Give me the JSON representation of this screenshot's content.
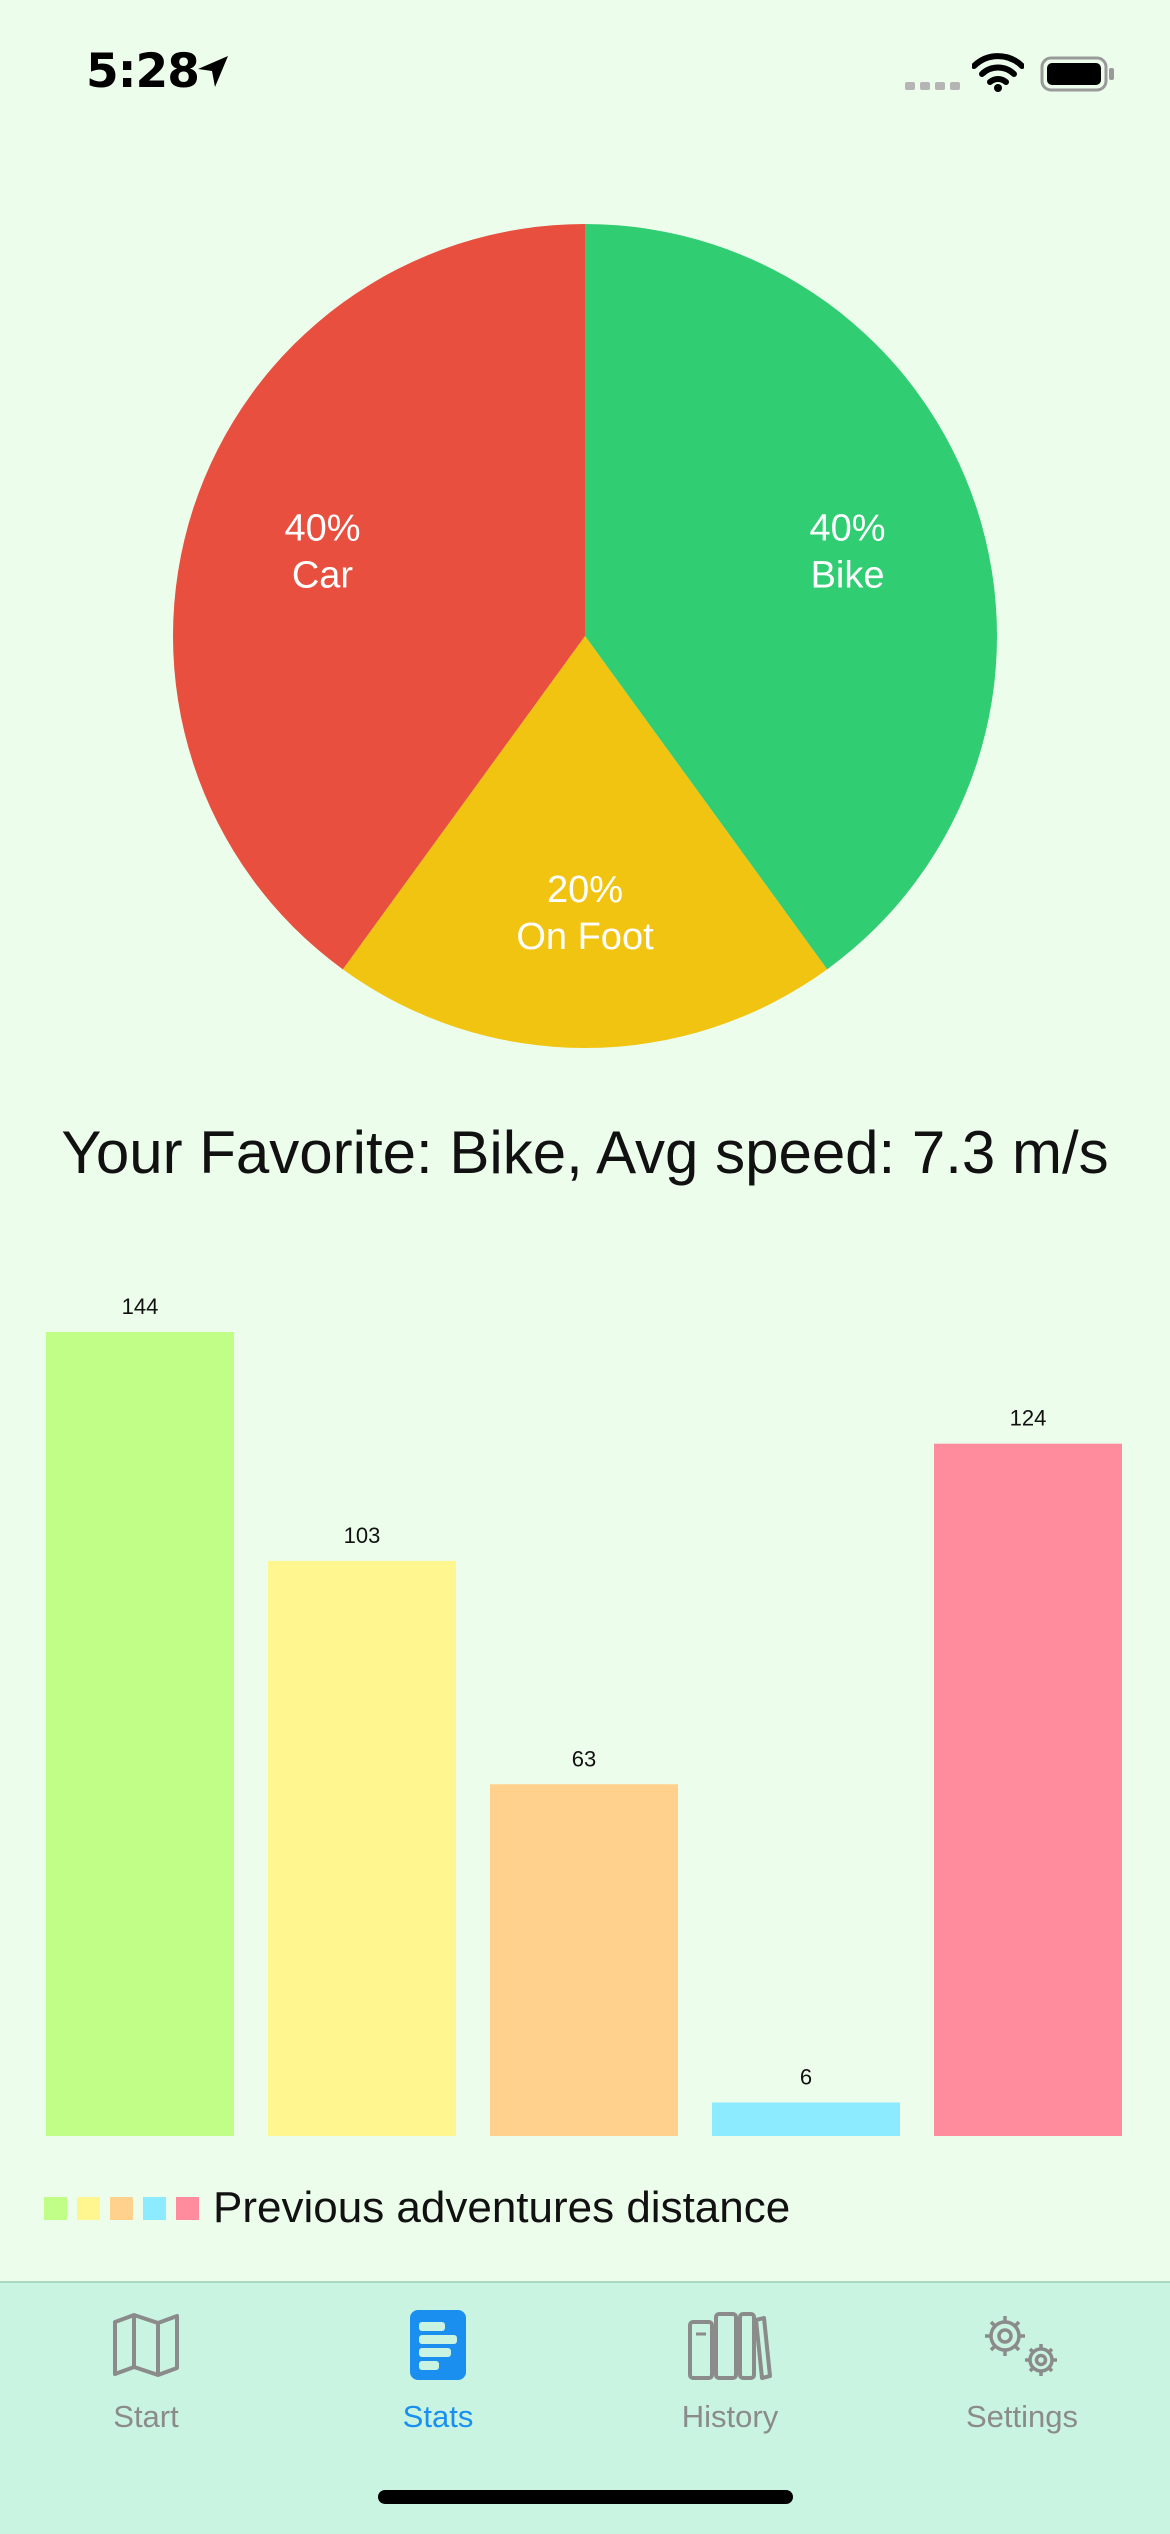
{
  "status_bar": {
    "time": "5:28"
  },
  "pie": {
    "slices": [
      {
        "label": "Bike",
        "percent_text": "40%",
        "value": 40,
        "color": "#31cd72"
      },
      {
        "label": "On Foot",
        "percent_text": "20%",
        "value": 20,
        "color": "#f1c412"
      },
      {
        "label": "Car",
        "percent_text": "40%",
        "value": 40,
        "color": "#e84f3e"
      }
    ]
  },
  "favorite": {
    "text": "Your Favorite: Bike, Avg speed: 7.3 m/s"
  },
  "chart_data": {
    "type": "bar",
    "values": [
      144,
      103,
      63,
      6,
      124
    ],
    "colors": [
      "#c1fe87",
      "#fff68f",
      "#ffd18c",
      "#8cebff",
      "#ff8c9d"
    ],
    "ylim": [
      0,
      144
    ],
    "legend": "Previous adventures distance",
    "legend_position": "bottom-left"
  },
  "tabs": [
    {
      "label": "Start",
      "icon": "map-icon",
      "active": false
    },
    {
      "label": "Stats",
      "icon": "stats-icon",
      "active": true
    },
    {
      "label": "History",
      "icon": "books-icon",
      "active": false
    },
    {
      "label": "Settings",
      "icon": "gears-icon",
      "active": false
    }
  ]
}
